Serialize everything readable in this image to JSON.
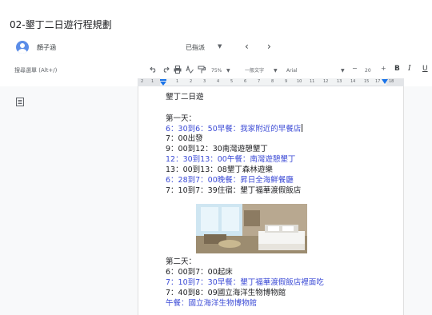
{
  "document": {
    "title": "02-墾丁二日遊行程規劃"
  },
  "account": {
    "name": "顏子涵",
    "mode": "已指派"
  },
  "toolbar": {
    "search_placeholder": "搜尋選單 (Alt+/)",
    "zoom": "75%",
    "style": "一般文字",
    "font": "Arial",
    "font_size": "20",
    "minus": "−",
    "plus": "+",
    "bold": "B",
    "italic": "I",
    "underline": "U"
  },
  "ruler": {
    "ticks": [
      "2",
      "1",
      "1",
      "2",
      "3",
      "4",
      "5",
      "6",
      "7",
      "8",
      "9",
      "10",
      "11",
      "12",
      "13",
      "14",
      "15",
      "17",
      "18"
    ]
  },
  "content": {
    "heading": "墾丁二日遊",
    "lines": [
      {
        "text": "第一天：",
        "color": "#202124"
      },
      {
        "text": "6：30到6：50早餐：我家附近的早餐店",
        "color": "#3c4bd6",
        "cursor": true
      },
      {
        "text": "7：00出發",
        "color": "#202124"
      },
      {
        "text": "9：00到12：30南灣遊憩墾丁",
        "color": "#202124"
      },
      {
        "text": "12：30到13：00午餐：南灣遊憩墾丁",
        "color": "#3c4bd6"
      },
      {
        "text": "13：00到13：08墾丁森林遊樂",
        "color": "#202124"
      },
      {
        "text": "6：28到7：00晚餐：昇日全海鮮餐廳",
        "color": "#3c4bd6"
      },
      {
        "text": "7：10到7：39住宿：墾丁福華渡假飯店",
        "color": "#202124"
      },
      {
        "text": "第二天：",
        "color": "#202124"
      },
      {
        "text": "6：00到7：00起床",
        "color": "#202124"
      },
      {
        "text": "7：10到7：30早餐：墾丁福華渡假飯店裡面吃",
        "color": "#3c4bd6"
      },
      {
        "text": "7：40到8：09國立海洋生物博物館",
        "color": "#202124"
      },
      {
        "text": "午餐：國立海洋生物博物館",
        "color": "#3c4bd6"
      }
    ]
  },
  "colors": {
    "accent": "#1a73e8",
    "link_text": "#3c4bd6",
    "page_bg": "#f8f9fa"
  }
}
